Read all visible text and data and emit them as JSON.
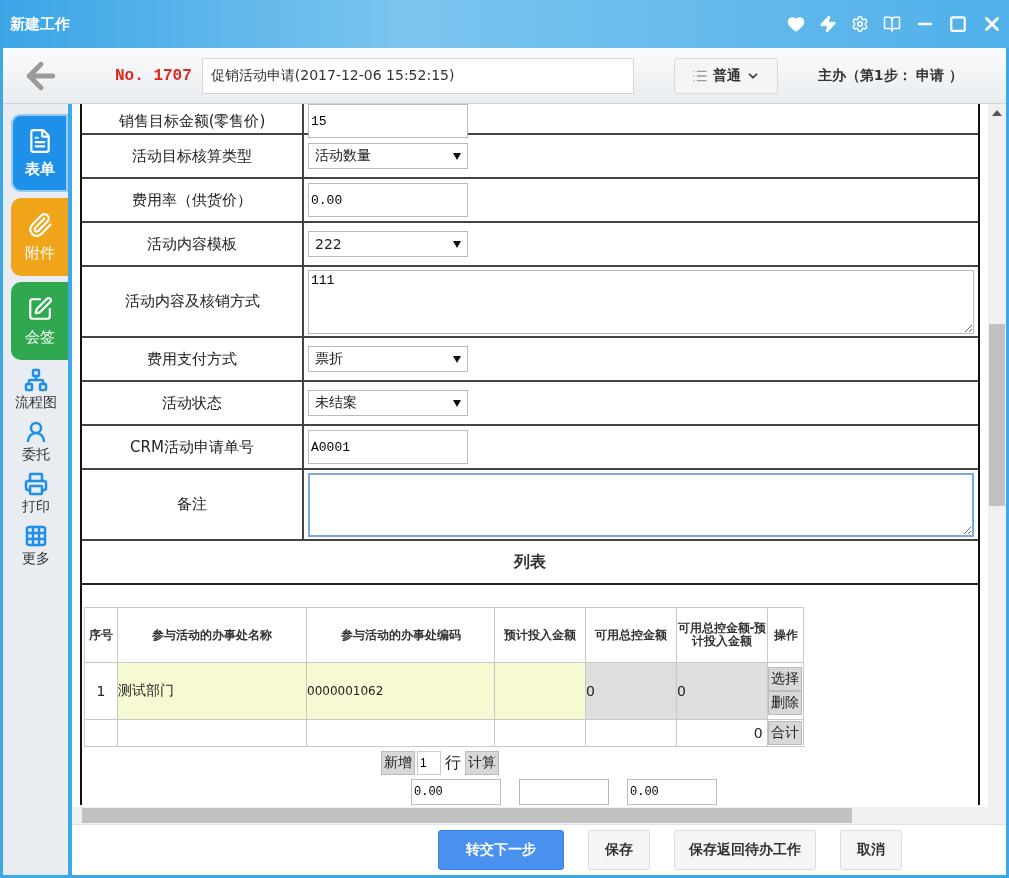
{
  "window": {
    "title": "新建工作"
  },
  "header": {
    "number": "No. 1707",
    "subject": "促销活动申请(2017-12-06 15:52:15)",
    "priority": "普通",
    "step": "主办（第1步： 申请 ）"
  },
  "sidebar": {
    "items": [
      {
        "label": "表单",
        "kind": "tile",
        "color": "#1e90e8",
        "selected": true
      },
      {
        "label": "附件",
        "kind": "tile",
        "color": "#f0a419",
        "selected": false
      },
      {
        "label": "会签",
        "kind": "tile",
        "color": "#2fa84f",
        "selected": false
      },
      {
        "label": "流程图",
        "kind": "tool"
      },
      {
        "label": "委托",
        "kind": "tool"
      },
      {
        "label": "打印",
        "kind": "tool"
      },
      {
        "label": "更多",
        "kind": "tool"
      }
    ]
  },
  "form": {
    "rows": [
      {
        "label": "销售目标金额(零售价)",
        "kind": "input",
        "value": "15"
      },
      {
        "label": "活动目标核算类型",
        "kind": "select",
        "value": "活动数量"
      },
      {
        "label": "费用率（供货价）",
        "kind": "input",
        "value": "0.00"
      },
      {
        "label": "活动内容模板",
        "kind": "select",
        "value": "222"
      },
      {
        "label": "活动内容及核销方式",
        "kind": "textarea",
        "value": "111",
        "focused": false
      },
      {
        "label": "费用支付方式",
        "kind": "select",
        "value": "票折"
      },
      {
        "label": "活动状态",
        "kind": "select",
        "value": "未结案"
      },
      {
        "label": "CRM活动申请单号",
        "kind": "input",
        "value": "A0001"
      },
      {
        "label": "备注",
        "kind": "textarea",
        "focused": true
      }
    ]
  },
  "list": {
    "title": "列表",
    "columns": [
      "序号",
      "参与活动的办事处名称",
      "参与活动的办事处编码",
      "预计投入金额",
      "可用总控金额",
      "可用总控金额-预计投入金额",
      "操作"
    ],
    "rows": [
      {
        "cells": [
          {
            "value": "1",
            "kind": "plain"
          },
          {
            "value": "测试部门",
            "kind": "editable"
          },
          {
            "value": "0000001062",
            "kind": "editable"
          },
          {
            "kind": "editable"
          },
          {
            "value": "0",
            "kind": "readonly"
          },
          {
            "value": "0",
            "kind": "readonly"
          }
        ],
        "actions": [
          "选择",
          "删除"
        ]
      }
    ],
    "total": {
      "value": "0",
      "action": "合计"
    },
    "add": {
      "button": "新增",
      "count": "1",
      "unit": "行",
      "calc": "计算"
    },
    "sums": [
      {
        "kind": "filled",
        "value": "0.00"
      },
      {
        "kind": "blank"
      },
      {
        "kind": "filled",
        "value": "0.00"
      }
    ]
  },
  "footer": {
    "buttons": [
      {
        "label": "转交下一步",
        "kind": "primary"
      },
      {
        "label": "保存",
        "kind": "default"
      },
      {
        "label": "保存返回待办工作",
        "kind": "default"
      },
      {
        "label": "取消",
        "kind": "default"
      }
    ]
  }
}
